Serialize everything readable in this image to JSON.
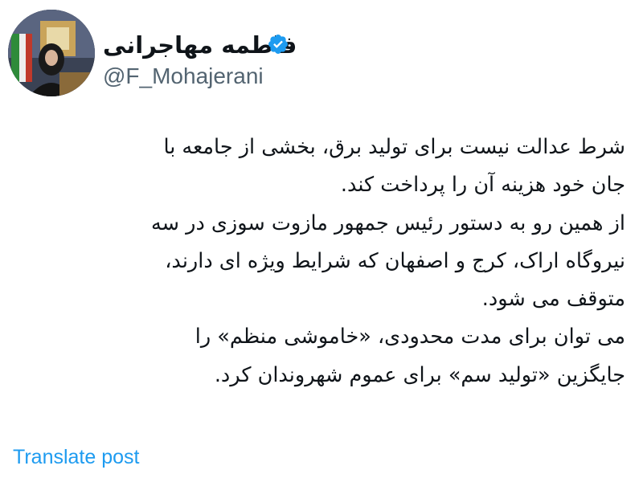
{
  "user": {
    "display_name": "فاطمه مهاجرانی",
    "handle": "@F_Mohajerani",
    "verified_badge_icon": "verified-check-icon",
    "badge_color": "#1d9bf0"
  },
  "post": {
    "lines": [
      "شرط عدالت نیست برای تولید برق، بخشی از جامعه با",
      "جان خود هزینه آن را پرداخت کند.",
      "از همین رو به دستور رئیس جمهور مازوت سوزی در سه",
      "نیروگاه اراک، کرج و اصفهان که شرایط ویژه ای دارند،",
      "متوقف می شود.",
      "می توان برای مدت محدودی، «خاموشی منظم» را",
      "جایگزین «تولید سم» برای عموم شهروندان کرد."
    ]
  },
  "actions": {
    "translate_label": "Translate post"
  },
  "colors": {
    "text": "#0f1419",
    "secondary_text": "#536471",
    "link": "#1d9bf0"
  }
}
